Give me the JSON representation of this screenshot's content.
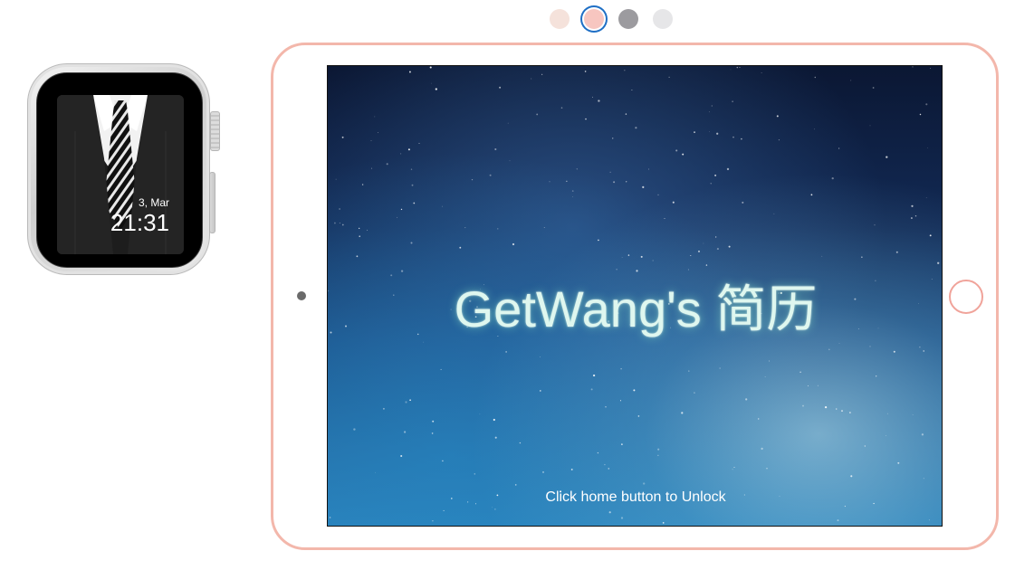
{
  "swatches": [
    {
      "name": "champagne",
      "color": "#f5e2db",
      "selected": false
    },
    {
      "name": "rose-gold",
      "color": "#f7c6c0",
      "selected": true
    },
    {
      "name": "space-gray",
      "color": "#9c9b9f",
      "selected": false
    },
    {
      "name": "silver",
      "color": "#e6e6e8",
      "selected": false
    }
  ],
  "watch": {
    "date": "3, Mar",
    "time": "21:31"
  },
  "ipad": {
    "title": "GetWang's 简历",
    "unlock_hint": "Click home button to Unlock",
    "frame_color": "#f3b7ab"
  }
}
